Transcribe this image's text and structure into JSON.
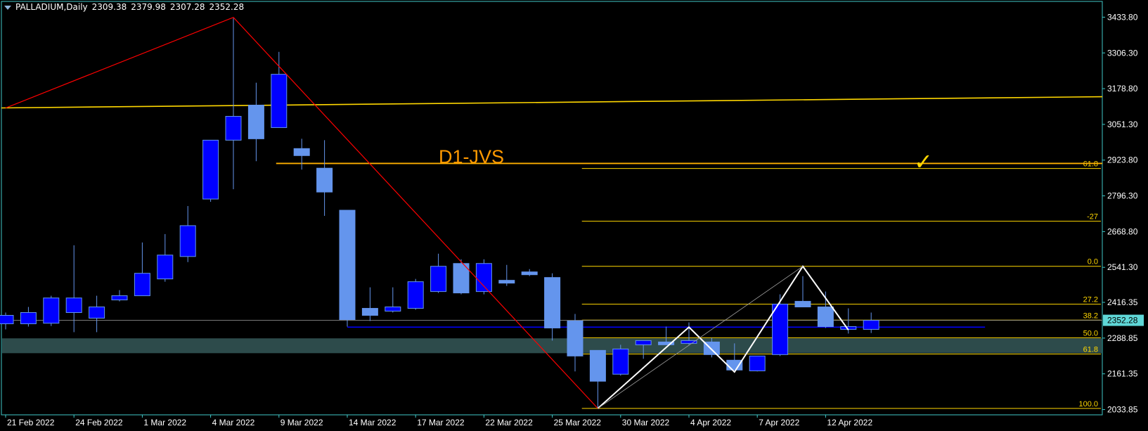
{
  "header": {
    "symbol": "PALLADIUM,Daily",
    "open": "2309.38",
    "high": "2379.98",
    "low": "2307.28",
    "close": "2352.28"
  },
  "annotation_label": "D1-JVS",
  "checkmark": "✓",
  "colors": {
    "background": "#000000",
    "frame": "#40c8c8",
    "bull_fill": "#6495ed",
    "bear_fill": "#0000ff",
    "yellow": "#ffd700",
    "red": "#ff0000",
    "label_orange": "#ff9900",
    "zone": "#2f4f4f"
  },
  "chart_data": {
    "type": "candlestick",
    "symbol": "PALLADIUM",
    "timeframe": "Daily",
    "ylim": [
      1990.0,
      3475.0
    ],
    "y_ticks": [
      "3433.80",
      "3306.30",
      "3178.80",
      "3051.30",
      "2923.80",
      "2796.30",
      "2668.80",
      "2541.30",
      "2416.35",
      "2288.85",
      "2161.35",
      "2033.85"
    ],
    "x_ticks": [
      {
        "label": "21 Feb 2022",
        "index": 1
      },
      {
        "label": "24 Feb 2022",
        "index": 4
      },
      {
        "label": "1 Mar 2022",
        "index": 7
      },
      {
        "label": "4 Mar 2022",
        "index": 10
      },
      {
        "label": "9 Mar 2022",
        "index": 13
      },
      {
        "label": "14 Mar 2022",
        "index": 16
      },
      {
        "label": "17 Mar 2022",
        "index": 19
      },
      {
        "label": "22 Mar 2022",
        "index": 22
      },
      {
        "label": "25 Mar 2022",
        "index": 25
      },
      {
        "label": "30 Mar 2022",
        "index": 28
      },
      {
        "label": "4 Apr 2022",
        "index": 31
      },
      {
        "label": "7 Apr 2022",
        "index": 34
      },
      {
        "label": "12 Apr 2022",
        "index": 37
      }
    ],
    "candles": [
      {
        "o": 2340,
        "h": 2380,
        "l": 2320,
        "c": 2370
      },
      {
        "o": 2340,
        "h": 2400,
        "l": 2330,
        "c": 2380
      },
      {
        "o": 2342,
        "h": 2440,
        "l": 2332,
        "c": 2432
      },
      {
        "o": 2380,
        "h": 2620,
        "l": 2310,
        "c": 2432
      },
      {
        "o": 2360,
        "h": 2440,
        "l": 2310,
        "c": 2400
      },
      {
        "o": 2425,
        "h": 2460,
        "l": 2420,
        "c": 2440
      },
      {
        "o": 2440,
        "h": 2630,
        "l": 2440,
        "c": 2520
      },
      {
        "o": 2500,
        "h": 2660,
        "l": 2490,
        "c": 2585
      },
      {
        "o": 2580,
        "h": 2760,
        "l": 2560,
        "c": 2690
      },
      {
        "o": 2785,
        "h": 2985,
        "l": 2775,
        "c": 2995
      },
      {
        "o": 2995,
        "h": 3430,
        "l": 2820,
        "c": 3080
      },
      {
        "o": 3120,
        "h": 3200,
        "l": 2920,
        "c": 3000
      },
      {
        "o": 3040,
        "h": 3310,
        "l": 3040,
        "c": 3230
      },
      {
        "o": 2965,
        "h": 3000,
        "l": 2890,
        "c": 2940
      },
      {
        "o": 2895,
        "h": 2995,
        "l": 2725,
        "c": 2810
      },
      {
        "o": 2745,
        "h": 2745,
        "l": 2330,
        "c": 2355
      },
      {
        "o": 2395,
        "h": 2470,
        "l": 2350,
        "c": 2370
      },
      {
        "o": 2385,
        "h": 2470,
        "l": 2380,
        "c": 2400
      },
      {
        "o": 2395,
        "h": 2500,
        "l": 2390,
        "c": 2490
      },
      {
        "o": 2455,
        "h": 2590,
        "l": 2450,
        "c": 2545
      },
      {
        "o": 2555,
        "h": 2570,
        "l": 2445,
        "c": 2450
      },
      {
        "o": 2455,
        "h": 2570,
        "l": 2445,
        "c": 2555
      },
      {
        "o": 2495,
        "h": 2550,
        "l": 2475,
        "c": 2485
      },
      {
        "o": 2525,
        "h": 2535,
        "l": 2510,
        "c": 2515
      },
      {
        "o": 2505,
        "h": 2520,
        "l": 2280,
        "c": 2325
      },
      {
        "o": 2350,
        "h": 2375,
        "l": 2170,
        "c": 2225
      },
      {
        "o": 2245,
        "h": 2240,
        "l": 2040,
        "c": 2135
      },
      {
        "o": 2160,
        "h": 2265,
        "l": 2155,
        "c": 2250
      },
      {
        "o": 2265,
        "h": 2275,
        "l": 2215,
        "c": 2280
      },
      {
        "o": 2275,
        "h": 2330,
        "l": 2275,
        "c": 2265
      },
      {
        "o": 2270,
        "h": 2345,
        "l": 2265,
        "c": 2280
      },
      {
        "o": 2275,
        "h": 2290,
        "l": 2220,
        "c": 2230
      },
      {
        "o": 2210,
        "h": 2270,
        "l": 2175,
        "c": 2175
      },
      {
        "o": 2172,
        "h": 2225,
        "l": 2170,
        "c": 2225
      },
      {
        "o": 2230,
        "h": 2445,
        "l": 2225,
        "c": 2410
      },
      {
        "o": 2420,
        "h": 2510,
        "l": 2400,
        "c": 2400
      },
      {
        "o": 2400,
        "h": 2455,
        "l": 2325,
        "c": 2330
      },
      {
        "o": 2320,
        "h": 2395,
        "l": 2305,
        "c": 2330
      },
      {
        "o": 2320,
        "h": 2380,
        "l": 2307,
        "c": 2352
      }
    ],
    "fibonacci_left": {
      "labels": [
        "61.8",
        "-27",
        "0.0",
        "27.2",
        "38.2",
        "50.0",
        "61.8",
        "100.0"
      ],
      "values": [
        2894,
        2706,
        2545,
        2410,
        2353,
        2290,
        2232,
        2038
      ]
    },
    "trendline_yellow": {
      "from": {
        "index": 0,
        "price": 3110
      },
      "to": {
        "index": 48,
        "price": 3150
      }
    },
    "resistance_orange": {
      "from": {
        "index": 12,
        "price": 2912
      },
      "to": {
        "index": 48,
        "price": 2912
      }
    },
    "support_blue": {
      "from": {
        "index": 15,
        "price": 2328
      },
      "to": {
        "index": 43,
        "price": 2328
      }
    },
    "current_price": {
      "label": "2352.28",
      "value": 2352.28
    },
    "zone": {
      "low": 2235,
      "high": 2288
    },
    "zigzag_red": [
      {
        "index": 0,
        "price": 3110
      },
      {
        "index": 10,
        "price": 3433
      },
      {
        "index": 26,
        "price": 2038
      }
    ],
    "zigzag_white": [
      {
        "index": 26,
        "price": 2038
      },
      {
        "index": 30,
        "price": 2328
      },
      {
        "index": 32,
        "price": 2168
      },
      {
        "index": 35,
        "price": 2545
      },
      {
        "index": 37,
        "price": 2318
      }
    ]
  }
}
